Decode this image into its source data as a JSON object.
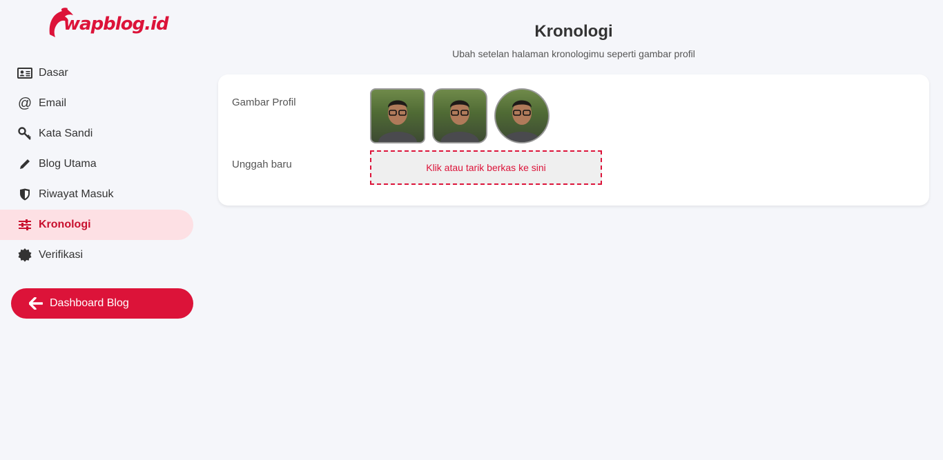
{
  "brand": {
    "name": "wapblog.id",
    "color": "#dc1339"
  },
  "sidebar": {
    "items": [
      {
        "label": "Dasar",
        "icon": "id-card-icon"
      },
      {
        "label": "Email",
        "icon": "at-icon"
      },
      {
        "label": "Kata Sandi",
        "icon": "key-icon"
      },
      {
        "label": "Blog Utama",
        "icon": "pencil-icon"
      },
      {
        "label": "Riwayat Masuk",
        "icon": "shield-icon"
      },
      {
        "label": "Kronologi",
        "icon": "sliders-icon",
        "active": true
      },
      {
        "label": "Verifikasi",
        "icon": "badge-icon"
      }
    ],
    "dashboard_button": {
      "label": "Dashboard Blog",
      "icon": "arrow-left-icon"
    }
  },
  "main": {
    "title": "Kronologi",
    "subtitle": "Ubah setelan halaman kronologimu seperti gambar profil",
    "profile_label": "Gambar Profil",
    "upload_label": "Unggah baru",
    "dropzone_text": "Klik atau tarik berkas ke sini",
    "avatar_shapes": [
      "square",
      "rounded",
      "circle"
    ]
  }
}
